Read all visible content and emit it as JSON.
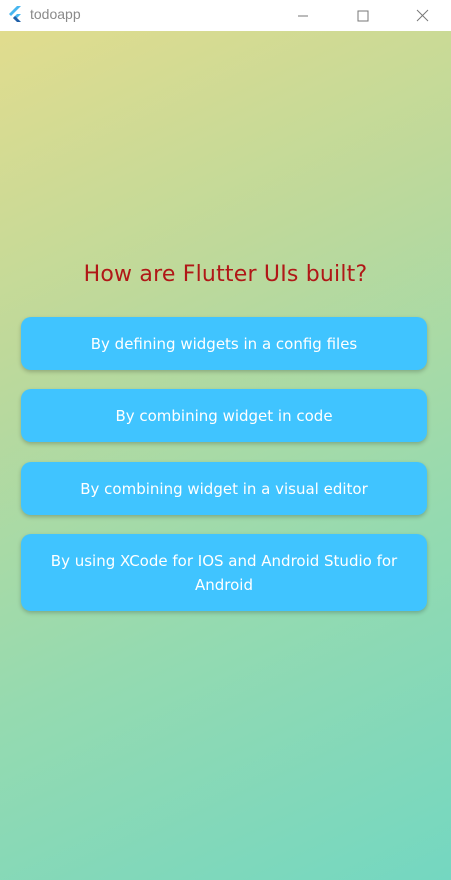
{
  "window": {
    "title": "todoapp",
    "icon": "flutter-logo-icon",
    "controls": [
      "minimize-icon",
      "maximize-icon",
      "close-icon"
    ]
  },
  "quiz": {
    "question": "How are Flutter UIs built?",
    "answers": [
      "By defining widgets in a config files",
      "By combining widget in code",
      "By combining widget in a visual editor",
      "By using XCode for IOS and Android Studio for Android"
    ]
  },
  "colors": {
    "question_text": "#b01717",
    "answer_button": "#40c4ff",
    "answer_text": "#ffffff",
    "gradient_start": "#e1dc8e",
    "gradient_end": "#74d7c1"
  }
}
